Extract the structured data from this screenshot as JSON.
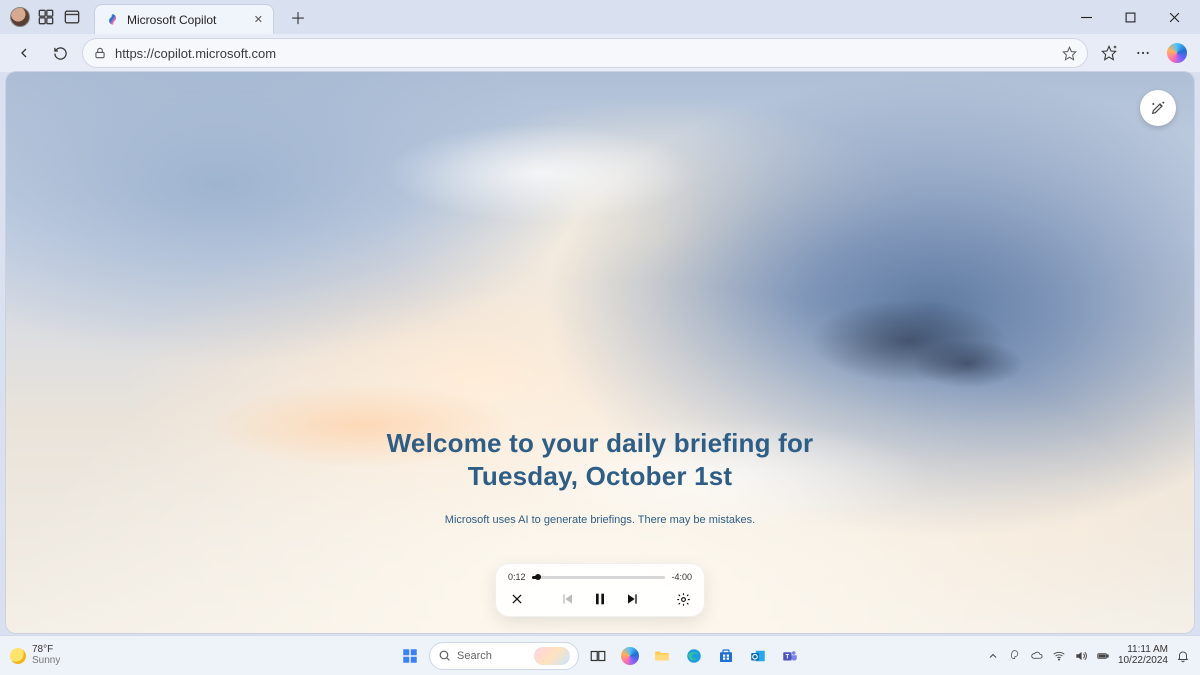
{
  "browser": {
    "tab_title": "Microsoft Copilot",
    "url": "https://copilot.microsoft.com"
  },
  "page": {
    "headline_line1": "Welcome to your daily briefing for",
    "headline_line2": "Tuesday, October 1st",
    "disclaimer": "Microsoft uses AI to generate briefings. There may be mistakes."
  },
  "player": {
    "elapsed": "0:12",
    "remaining": "-4:00",
    "progress_pct": 5
  },
  "taskbar": {
    "weather_temp": "78°F",
    "weather_cond": "Sunny",
    "search_placeholder": "Search",
    "time": "11:11 AM",
    "date": "10/22/2024"
  }
}
